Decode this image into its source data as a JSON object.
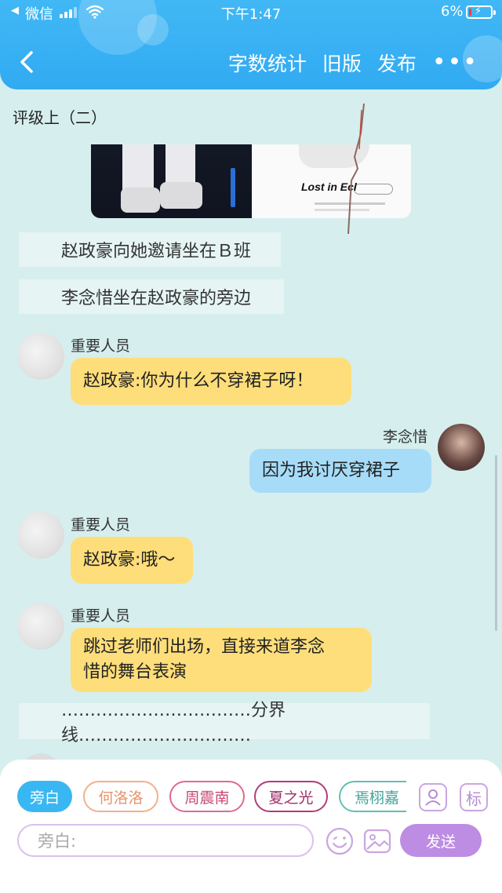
{
  "status_bar": {
    "back_app": "微信",
    "time": "下午1:47",
    "battery_pct": "6%",
    "battery_level": 0.06
  },
  "header": {
    "actions": [
      "字数统计",
      "旧版",
      "发布"
    ],
    "more": "•••"
  },
  "chapter_title": "评级上（二）",
  "image_caption": "Lost in Ecl",
  "messages": [
    {
      "type": "narration",
      "text": "赵政豪向她邀请坐在Ｂ班"
    },
    {
      "type": "narration",
      "text": "李念惜坐在赵政豪的旁边"
    },
    {
      "type": "left",
      "speaker": "重要人员",
      "text": "赵政豪:你为什么不穿裙子呀！"
    },
    {
      "type": "right",
      "speaker": "李念惜",
      "text": "因为我讨厌穿裙子"
    },
    {
      "type": "left",
      "speaker": "重要人员",
      "text": "赵政豪:哦～"
    },
    {
      "type": "left",
      "speaker": "重要人员",
      "text_line1": "跳过老师们出场，直接来道李念",
      "text_line2": "惜的舞台表演"
    },
    {
      "type": "narration",
      "text": "……………………………分界线…………………………"
    }
  ],
  "roles": [
    {
      "label": "旁白",
      "color": "#39b7f2",
      "active": true
    },
    {
      "label": "何洛洛",
      "color": "#f3b08a",
      "active": false
    },
    {
      "label": "周震南",
      "color": "#e2698c",
      "active": false
    },
    {
      "label": "夏之光",
      "color": "#b13d7a",
      "active": false
    },
    {
      "label": "焉栩嘉",
      "color": "#5fc0b6",
      "active": false
    }
  ],
  "role_icons": [
    "person-icon",
    "tag-icon"
  ],
  "tag_icon_label": "标",
  "input": {
    "placeholder": "旁白:"
  },
  "send_label": "发送",
  "colors": {
    "header": "#39b0f4",
    "background": "#d6eeee",
    "yellow_bubble": "#fede7a",
    "blue_bubble": "#a7dcf8",
    "send_button": "#bd8ce3"
  }
}
